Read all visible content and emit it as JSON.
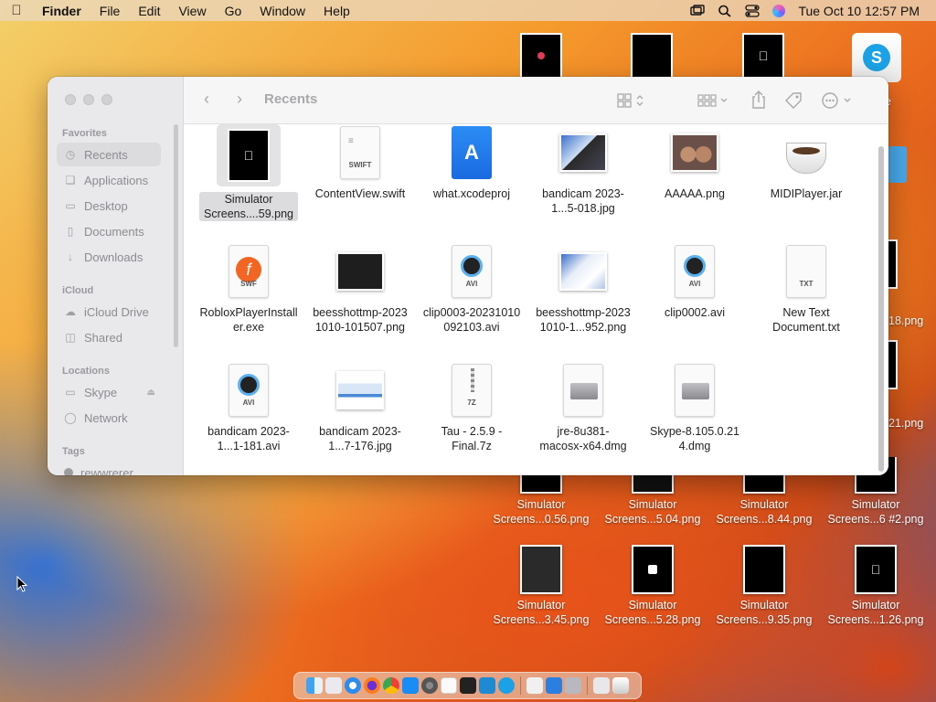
{
  "menubar": {
    "app": "Finder",
    "items": [
      "File",
      "Edit",
      "View",
      "Go",
      "Window",
      "Help"
    ],
    "clock": "Tue Oct 10  12:57 PM"
  },
  "desktop": {
    "top_icons": [
      "",
      "",
      ""
    ],
    "right_partial": [
      "e",
      "18.png",
      "21.png"
    ],
    "row1": [
      "Simulator Screens...0.56.png",
      "Simulator Screens...5.04.png",
      "Simulator Screens...8.44.png",
      "Simulator Screens...6 #2.png"
    ],
    "row2": [
      "Simulator Screens...3.45.png",
      "Simulator Screens...5.28.png",
      "Simulator Screens...9.35.png",
      "Simulator Screens...1.26.png"
    ]
  },
  "finder": {
    "title": "Recents",
    "sidebar": {
      "favorites_label": "Favorites",
      "favorites": [
        "Recents",
        "Applications",
        "Desktop",
        "Documents",
        "Downloads"
      ],
      "icloud_label": "iCloud",
      "icloud": [
        "iCloud Drive",
        "Shared"
      ],
      "locations_label": "Locations",
      "locations": [
        "Skype",
        "Network"
      ],
      "tags_label": "Tags",
      "tags": [
        "rewwrerer"
      ]
    },
    "files": [
      {
        "name": "Simulator Screens....59.png",
        "kind": "screenshot"
      },
      {
        "name": "ContentView.swift",
        "kind": "doc",
        "tag": "SWIFT"
      },
      {
        "name": "what.xcodeproj",
        "kind": "xcode"
      },
      {
        "name": "bandicam 2023-1...5-018.jpg",
        "kind": "image"
      },
      {
        "name": "AAAAA.png",
        "kind": "image"
      },
      {
        "name": "MIDIPlayer.jar",
        "kind": "jar"
      },
      {
        "name": "RobloxPlayerInstaller.exe",
        "kind": "swf",
        "tag": "SWF"
      },
      {
        "name": "beesshottmp-20231010-101507.png",
        "kind": "image"
      },
      {
        "name": "clip0003-20231010092103.avi",
        "kind": "avi",
        "tag": "AVI"
      },
      {
        "name": "beesshottmp-20231010-1...952.png",
        "kind": "image"
      },
      {
        "name": "clip0002.avi",
        "kind": "avi",
        "tag": "AVI"
      },
      {
        "name": "New Text Document.txt",
        "kind": "doc",
        "tag": "TXT"
      },
      {
        "name": "bandicam 2023-1...1-181.avi",
        "kind": "avi",
        "tag": "AVI"
      },
      {
        "name": "bandicam 2023-1...7-176.jpg",
        "kind": "image"
      },
      {
        "name": "Tau - 2.5.9 - Final.7z",
        "kind": "doc",
        "tag": "7Z"
      },
      {
        "name": "jre-8u381-macosx-x64.dmg",
        "kind": "dmg"
      },
      {
        "name": "Skype-8.105.0.214.dmg",
        "kind": "dmg"
      }
    ]
  }
}
